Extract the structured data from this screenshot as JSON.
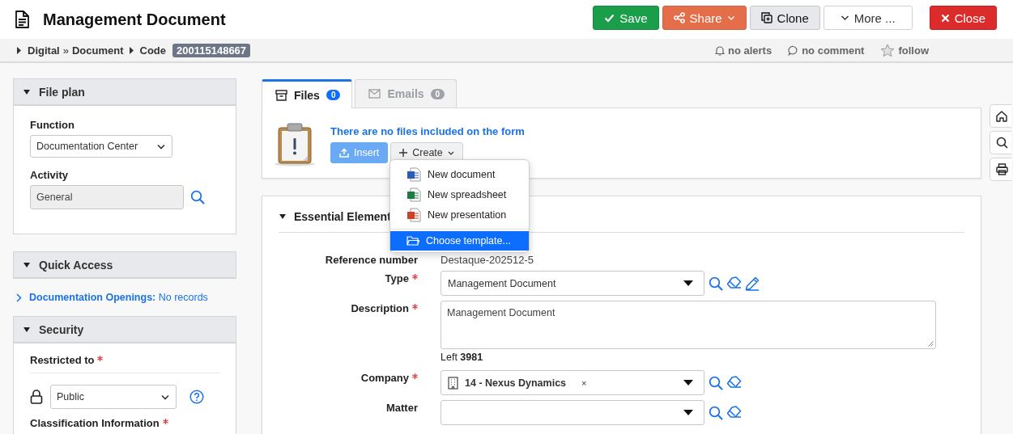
{
  "header": {
    "title": "Management Document",
    "buttons": [
      {
        "kind": "save",
        "label": "Save"
      },
      {
        "kind": "share",
        "label": "Share"
      },
      {
        "kind": "clone",
        "label": "Clone"
      },
      {
        "kind": "more",
        "label": "More ..."
      },
      {
        "kind": "close",
        "label": "Close"
      }
    ]
  },
  "breadcrumb": {
    "items": [
      "Digital",
      "Document"
    ],
    "separator": "»",
    "code_label": "Code",
    "code": "200115148667",
    "actions": [
      {
        "kind": "alerts",
        "label": "no alerts"
      },
      {
        "kind": "comment",
        "label": "no comment"
      },
      {
        "kind": "follow",
        "label": "follow"
      }
    ]
  },
  "sidebar": {
    "file_plan": {
      "title": "File plan",
      "expanded": true,
      "function_label": "Function",
      "function_value": "Documentation Center",
      "activity_label": "Activity",
      "activity_value": "General"
    },
    "quick_access": {
      "title": "Quick Access",
      "expanded": true,
      "link": "Documentation Openings:",
      "status": "No records"
    },
    "security": {
      "title": "Security",
      "expanded": true,
      "restricted_label": "Restricted to",
      "restricted_required": true,
      "restricted_value": "Public",
      "classification_label": "Classification Information",
      "classification_required": true
    }
  },
  "tabs": [
    {
      "label": "Files",
      "count": "0",
      "selected": true
    },
    {
      "label": "Emails",
      "count": "0",
      "selected": false
    }
  ],
  "files": {
    "empty_message": "There are no files included on the form",
    "insert_label": "Insert",
    "create_label": "Create",
    "create_menu": {
      "expanded": true,
      "items": [
        {
          "kind": "document",
          "label": "New document",
          "selected": false
        },
        {
          "kind": "spreadsheet",
          "label": "New spreadsheet",
          "selected": false
        },
        {
          "kind": "presentation",
          "label": "New presentation",
          "selected": false
        },
        {
          "kind": "template",
          "label": "Choose template...",
          "selected": true
        }
      ]
    }
  },
  "essential": {
    "title": "Essential Element",
    "expanded": true,
    "fields": [
      {
        "kind": "readonly",
        "label": "Reference number",
        "value": "Destaque-202512-5"
      },
      {
        "kind": "select",
        "label": "Type",
        "required": true,
        "value": "Management Document",
        "search": true,
        "clear": true,
        "edit": true
      },
      {
        "kind": "textarea",
        "label": "Description",
        "required": true,
        "value": "Management Document",
        "counter_label": "Left",
        "counter": "3981"
      },
      {
        "kind": "tag-select",
        "label": "Company",
        "required": true,
        "value": "14 - Nexus Dynamics",
        "remove": "×",
        "search": true,
        "clear": true
      },
      {
        "kind": "select",
        "label": "Matter",
        "search": true,
        "clear": true
      }
    ]
  }
}
